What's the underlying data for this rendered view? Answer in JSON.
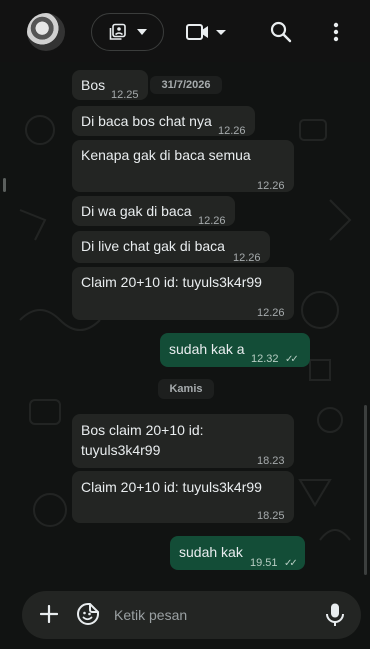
{
  "header": {
    "icons": {
      "avatar": "contact-avatar",
      "media": "media-gallery-icon",
      "video": "video-call-icon",
      "search": "search-icon",
      "more": "more-vertical-icon"
    }
  },
  "date_separator": "31/7/2026",
  "day_separator": "Kamis",
  "messages": [
    {
      "text": "Bos",
      "time": "12.25",
      "direction": "in"
    },
    {
      "text": "Di baca bos chat nya",
      "time": "12.26",
      "direction": "in"
    },
    {
      "text": "Kenapa gak di baca semua",
      "time": "12.26",
      "direction": "in"
    },
    {
      "text": "Di wa gak di baca",
      "time": "12.26",
      "direction": "in"
    },
    {
      "text": "Di live chat gak di baca",
      "time": "12.26",
      "direction": "in"
    },
    {
      "text": "Claim 20+10 id: tuyuls3k4r99",
      "time": "12.26",
      "direction": "in"
    },
    {
      "text": "sudah kak a",
      "time": "12.32",
      "direction": "out",
      "status": "✓✓"
    },
    {
      "text_line1": "Bos claim 20+10 id:",
      "text_line2": "tuyuls3k4r99",
      "time": "18.23",
      "direction": "in"
    },
    {
      "text": "Claim 20+10 id: tuyuls3k4r99",
      "time": "18.25",
      "direction": "in"
    },
    {
      "text": "sudah kak",
      "time": "19.51",
      "direction": "out",
      "status": "✓✓"
    }
  ],
  "composer": {
    "placeholder": "Ketik pesan",
    "icons": {
      "add": "plus-icon",
      "sticker": "sticker-icon",
      "mic": "microphone-icon"
    }
  },
  "colors": {
    "background": "#111312",
    "incoming_bubble": "#232523",
    "outgoing_bubble": "#134d37",
    "timestamp": "#a6abad"
  }
}
